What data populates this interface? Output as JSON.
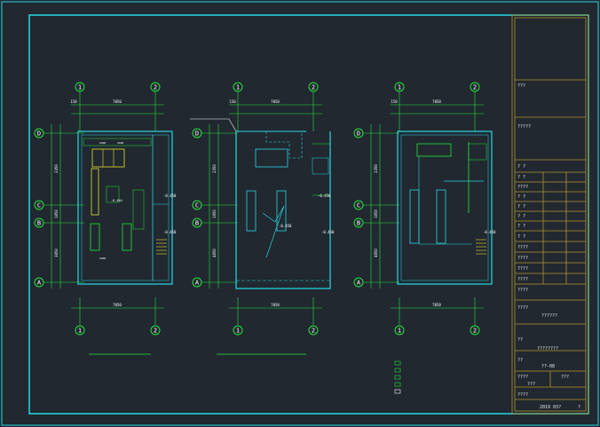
{
  "drawings": [
    {
      "id": "plan-1",
      "axes_top": [
        "1",
        "2"
      ],
      "axes_bottom": [
        "1",
        "2"
      ],
      "axes_side": [
        "D",
        "C",
        "B",
        "A"
      ],
      "dim_top": "7050",
      "dim_bottom": "7050",
      "dim_small": "150"
    },
    {
      "id": "plan-2",
      "axes_top": [
        "1",
        "2"
      ],
      "axes_bottom": [
        "1",
        "2"
      ],
      "axes_side": [
        "D",
        "C",
        "B",
        "A"
      ],
      "dim_top": "7050",
      "dim_bottom": "7050",
      "dim_small": "150"
    },
    {
      "id": "plan-3",
      "axes_top": [
        "1",
        "2"
      ],
      "axes_bottom": [
        "1",
        "2"
      ],
      "axes_side": [
        "D",
        "C",
        "B",
        "A"
      ],
      "dim_top": "7050",
      "dim_bottom": "7050",
      "dim_small": "150"
    }
  ],
  "side_dims": [
    "2350",
    "1050",
    "3050",
    "4050"
  ],
  "levels": [
    "-0.450",
    "-0.450",
    "-0.450",
    "-0.450",
    "-0.450"
  ],
  "plan1_labels": [
    "2400",
    "2400",
    "2400",
    "2400",
    "2400",
    "2400",
    "2400",
    "2400",
    "2400",
    "2400",
    "-0.450"
  ],
  "title_block": {
    "row1": "???",
    "row2": "?????",
    "row3": "? ?",
    "rows_small": [
      "? ?",
      "????",
      "? ?",
      "? ?",
      "? ?",
      "? ?",
      "? ?",
      "????",
      "????",
      "????",
      "????"
    ],
    "project_label": "????",
    "project_value": "??????",
    "drawing_label": "??",
    "drawing_value": "????????",
    "number_label": "??",
    "number_value": "??-08",
    "scale_label": "????",
    "scale_value": "???",
    "sheet_label": "???",
    "sheet_value": "???",
    "date_label": "????",
    "date_value": "2019 03?",
    "page_value": "?"
  },
  "colors": {
    "background": "#212830",
    "frame": "#26d9e6",
    "axis": "#22e53a",
    "wall": "#26d9e6",
    "title_block": "#b5922a",
    "equipment": "#e6e02a"
  }
}
